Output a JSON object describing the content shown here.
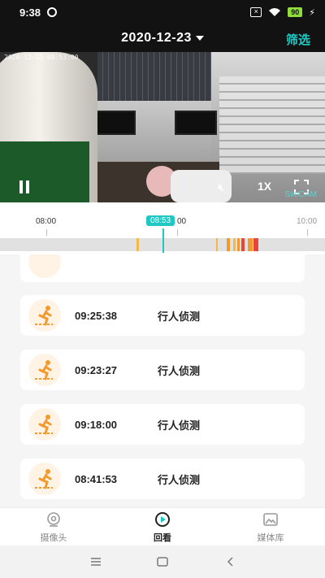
{
  "status_bar": {
    "time": "9:38",
    "battery": "90"
  },
  "header": {
    "date": "2020-12-23",
    "filter_label": "筛选"
  },
  "video": {
    "timestamp_overlay": "2020-12-23 08:53:00",
    "speed_label": "1X",
    "watermark": "SimCAM"
  },
  "timeline": {
    "labels": [
      "08:00",
      "08:53",
      "00",
      "10:00"
    ],
    "current_time": "08:53"
  },
  "events": [
    {
      "time": "09:25:38",
      "type": "行人侦测"
    },
    {
      "time": "09:23:27",
      "type": "行人侦测"
    },
    {
      "time": "09:18:00",
      "type": "行人侦测"
    },
    {
      "time": "08:41:53",
      "type": "行人侦测"
    }
  ],
  "bottom_nav": {
    "items": [
      {
        "label": "摄像头",
        "icon": "camera-icon"
      },
      {
        "label": "回看",
        "icon": "playback-icon"
      },
      {
        "label": "媒体库",
        "icon": "gallery-icon"
      }
    ]
  },
  "colors": {
    "accent": "#1fc8c2",
    "event_orange": "#f29a2e",
    "alert_red": "#e8463a"
  }
}
